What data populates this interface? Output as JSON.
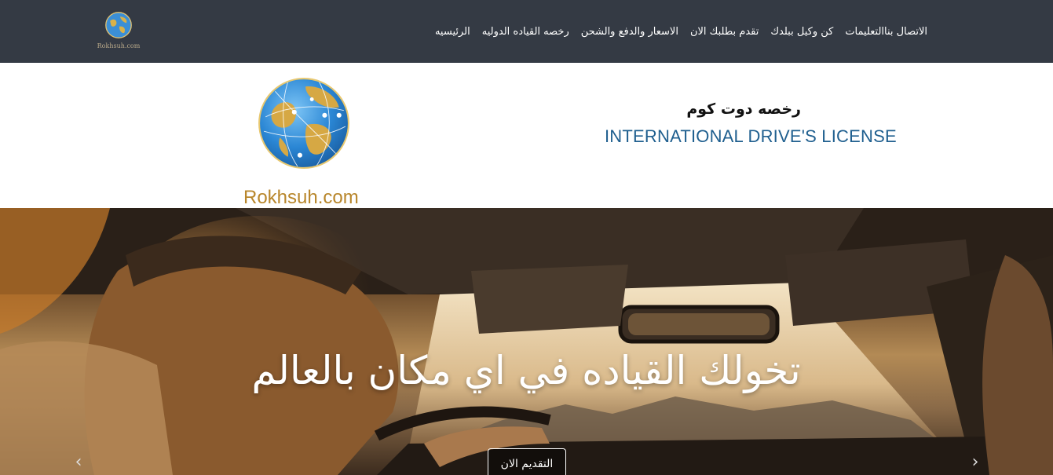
{
  "nav": {
    "logo_caption": "Rokhsuh.com",
    "items": [
      {
        "label": "الرئيسيه"
      },
      {
        "label": "رخصه القياده الدوليه"
      },
      {
        "label": "الاسعار والدفع والشحن"
      },
      {
        "label": "تقدم بطلبك الان"
      },
      {
        "label": "كن وكيل ببلدك"
      },
      {
        "label": "التعليمات"
      },
      {
        "label": "الاتصال بنا"
      }
    ]
  },
  "header": {
    "logo_caption": "Rokhsuh.com",
    "brand_arabic": "رخصه دوت كوم",
    "brand_english": "INTERNATIONAL DRIVE'S LICENSE"
  },
  "hero": {
    "title": "تخولك القياده في اي مكان بالعالم",
    "apply_label": "التقديم الان",
    "prev_glyph": "‹",
    "next_glyph": "›"
  },
  "colors": {
    "topbar": "#343a44",
    "brand_blue": "#1f5f8f",
    "logo_gold": "#b8862b"
  }
}
